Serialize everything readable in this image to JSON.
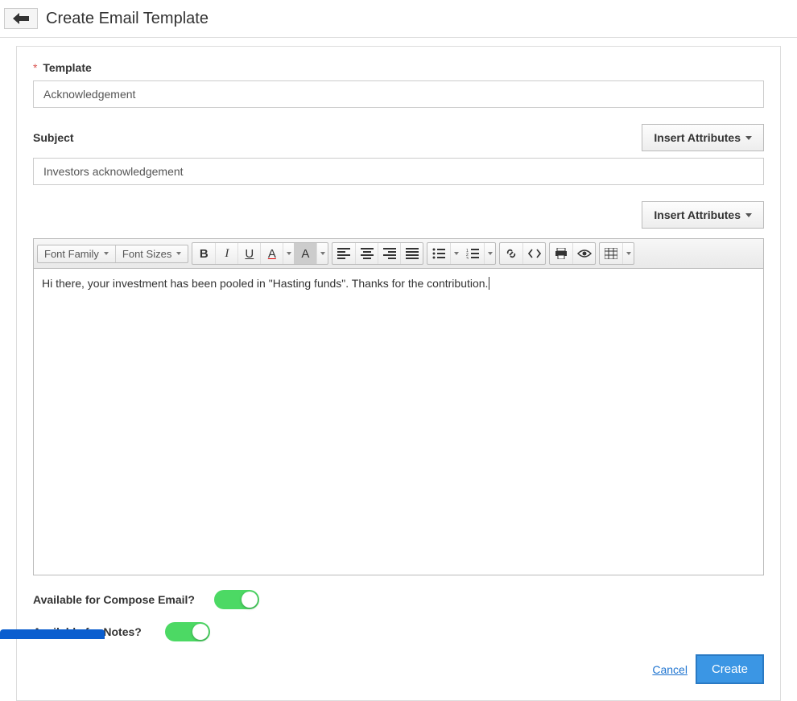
{
  "header": {
    "title": "Create Email Template"
  },
  "form": {
    "template": {
      "label": "Template",
      "required": true,
      "value": "Acknowledgement"
    },
    "subject": {
      "label": "Subject",
      "value": "Investors acknowledgement"
    },
    "insert_attributes_label": "Insert Attributes",
    "editor": {
      "font_family_label": "Font Family",
      "font_sizes_label": "Font Sizes",
      "content": "Hi there, your investment has been pooled in \"Hasting funds\". Thanks for the contribution."
    },
    "toggles": {
      "compose_email": {
        "label": "Available for Compose Email?",
        "on": true
      },
      "notes": {
        "label": "Available for Notes?",
        "on": true
      }
    },
    "actions": {
      "cancel": "Cancel",
      "create": "Create"
    }
  }
}
